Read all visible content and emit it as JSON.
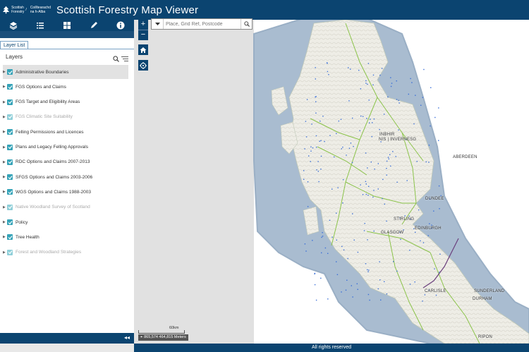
{
  "header": {
    "logo_line1": "Scottish",
    "logo_line2": "Forestry",
    "logo_line3": "Coilltearachd",
    "logo_line4": "na h-Alba",
    "title": "Scottish Forestry Map Viewer"
  },
  "toolbar": {
    "icons": [
      "layers-icon",
      "legend-list-icon",
      "basemap-grid-icon",
      "draw-pencil-icon",
      "info-icon"
    ]
  },
  "panel": {
    "tab_label": "Layer List",
    "layers_heading": "Layers",
    "layers": [
      {
        "label": "Administrative Boundaries",
        "selected": true,
        "dim": false
      },
      {
        "label": "FGS Options and Claims",
        "selected": false,
        "dim": false
      },
      {
        "label": "FGS Target and Eligibility Areas",
        "selected": false,
        "dim": false
      },
      {
        "label": "FGS Climatic Site Suitability",
        "selected": false,
        "dim": true
      },
      {
        "label": "Felling Permissions and Licences",
        "selected": false,
        "dim": false
      },
      {
        "label": "Plans and Legacy Felling Approvals",
        "selected": false,
        "dim": false
      },
      {
        "label": "RDC Options and Claims 2007-2013",
        "selected": false,
        "dim": false
      },
      {
        "label": "SFGS Options and Claims 2003-2006",
        "selected": false,
        "dim": false
      },
      {
        "label": "WGS Options and Claims 1988-2003",
        "selected": false,
        "dim": false
      },
      {
        "label": "Native Woodland Survey of Scotland",
        "selected": false,
        "dim": true
      },
      {
        "label": "Policy",
        "selected": false,
        "dim": false
      },
      {
        "label": "Tree Health",
        "selected": false,
        "dim": false
      },
      {
        "label": "Forest and Woodland Strategies",
        "selected": false,
        "dim": true
      }
    ]
  },
  "map": {
    "zoom_in": "+",
    "zoom_out": "−",
    "search_placeholder": "Place, Grid Ref, Postcode",
    "labels": {
      "inbhir": "INBHIR",
      "inverness": "NIS | INVERNESG",
      "aberdeen": "ABERDEEN",
      "dundee": "DUNDEE",
      "stirling": "STIRLING",
      "edinburgh": "EDINBURGH",
      "glasgow": "GLASGOW",
      "carlisle": "CARLISLE",
      "sunderland": "SUNDERLAND",
      "durham": "DURHAM",
      "ripon": "RIPON"
    },
    "scale_label": "60km",
    "coordinates": "865,574 464,815 Meters",
    "colors": {
      "sea": "#a9bcd0",
      "land": "#f2f1ec",
      "roads": "#8bc34a",
      "woodland": "#3a6fd8"
    }
  },
  "footer": {
    "text": "All rights reserved"
  }
}
